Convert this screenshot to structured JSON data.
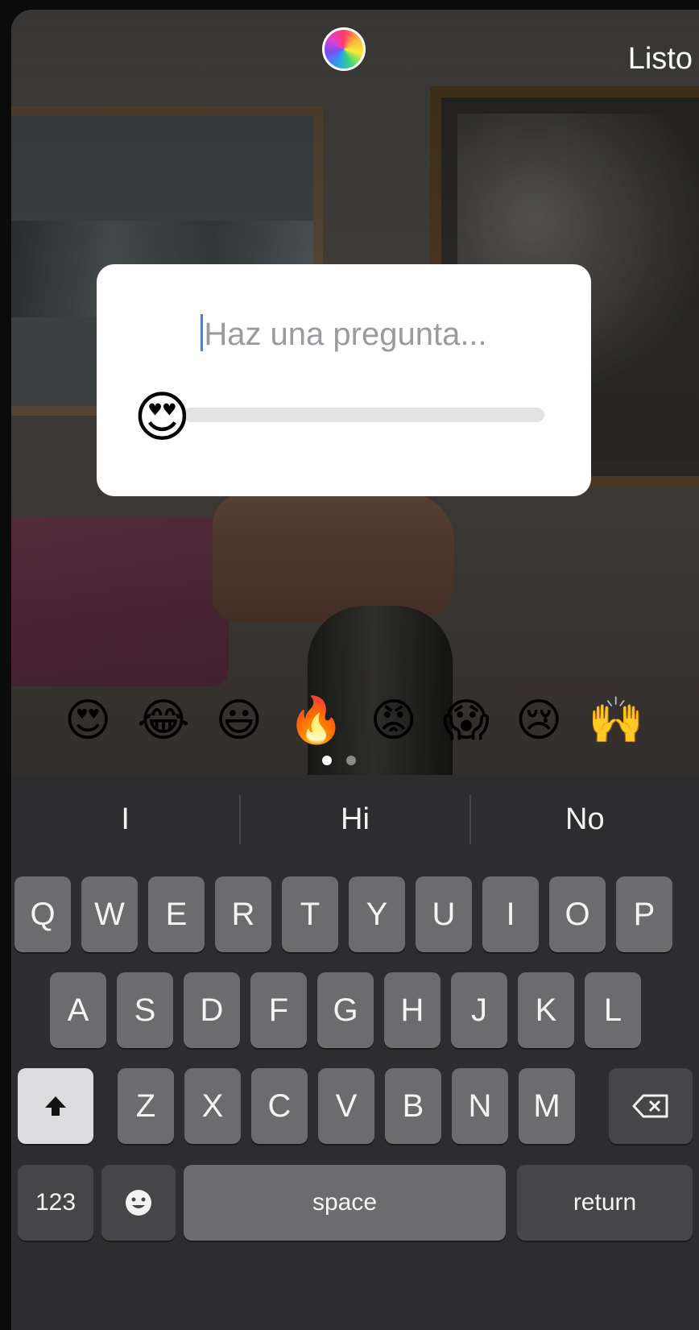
{
  "top_bar": {
    "color_picker_icon": "rainbow-circle",
    "done_label": "Listo"
  },
  "slider_sticker": {
    "question_placeholder": "Haz una pregunta...",
    "slider_emoji": "😍",
    "slider_value": 0.0
  },
  "emoji_choices": [
    "😍",
    "😂",
    "😃",
    "🔥",
    "😡",
    "😱",
    "😢",
    "🙌"
  ],
  "emoji_pages": {
    "count": 2,
    "active": 0
  },
  "keyboard": {
    "suggestions": [
      "I",
      "Hi",
      "No"
    ],
    "row1": [
      "Q",
      "W",
      "E",
      "R",
      "T",
      "Y",
      "U",
      "I",
      "O",
      "P"
    ],
    "row2": [
      "A",
      "S",
      "D",
      "F",
      "G",
      "H",
      "J",
      "K",
      "L"
    ],
    "row3": [
      "Z",
      "X",
      "C",
      "V",
      "B",
      "N",
      "M"
    ],
    "shift_icon": "shift-arrow-icon",
    "backspace_icon": "backspace-icon",
    "numbers_label": "123",
    "emoji_icon": "smiley-icon",
    "space_label": "space",
    "return_label": "return"
  }
}
